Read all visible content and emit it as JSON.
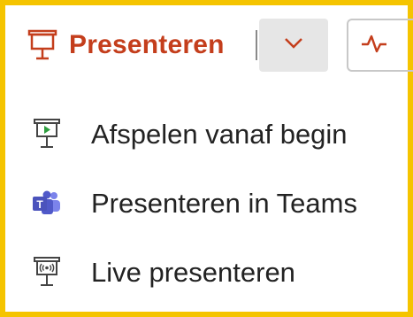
{
  "toolbar": {
    "present_label": "Presenteren",
    "present_icon": "presentation-screen-icon",
    "dropdown_icon": "chevron-down-icon",
    "activity_icon": "pulse-icon",
    "accent_color": "#c43e1c"
  },
  "menu": {
    "items": [
      {
        "label": "Afspelen vanaf begin",
        "icon": "play-from-start-icon"
      },
      {
        "label": "Presenteren in Teams",
        "icon": "teams-icon"
      },
      {
        "label": "Live presenteren",
        "icon": "live-present-icon"
      }
    ]
  }
}
